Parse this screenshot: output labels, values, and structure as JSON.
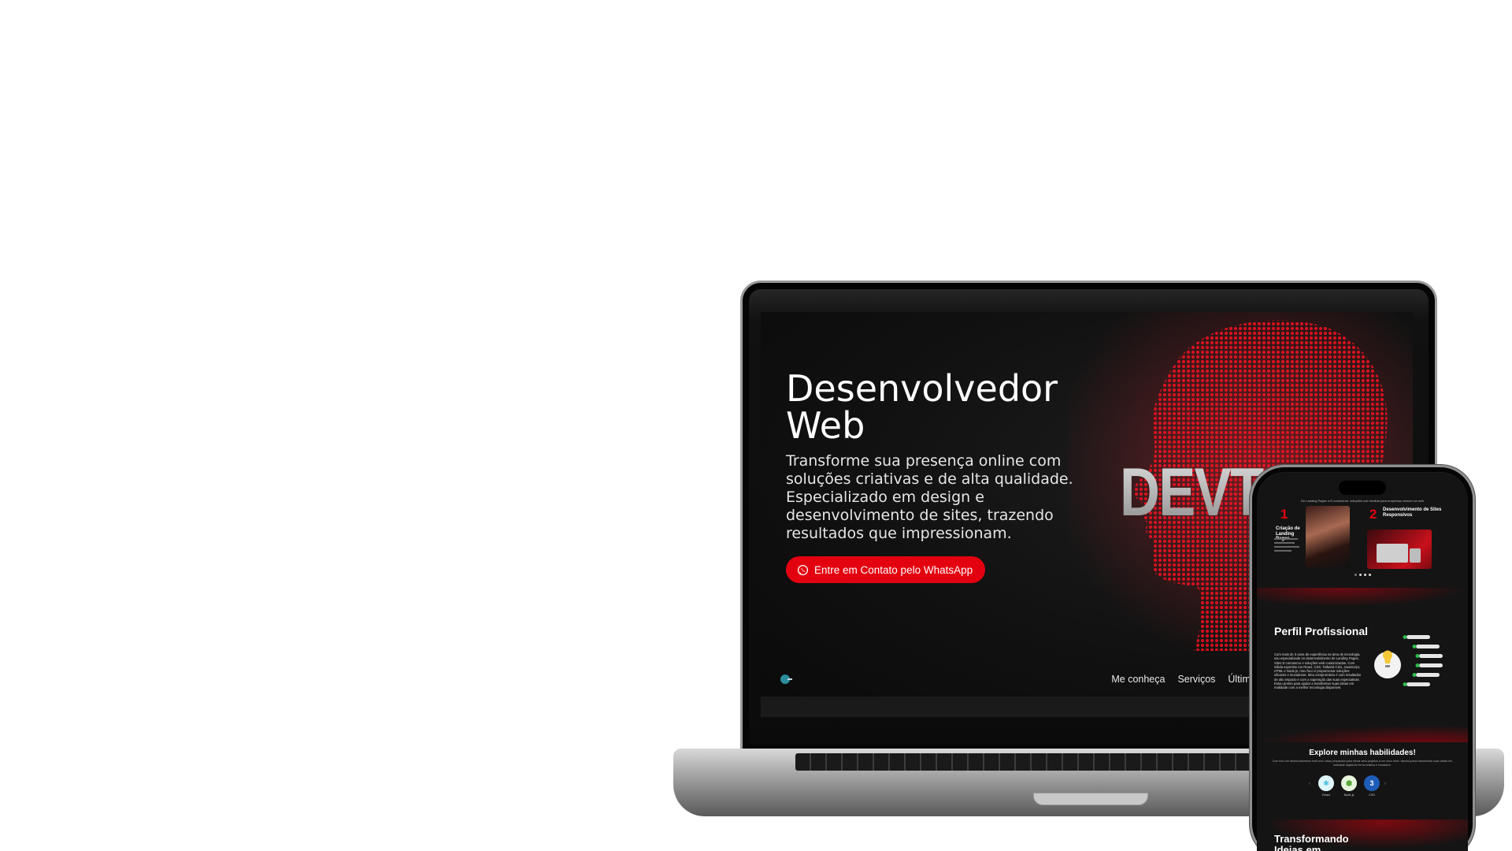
{
  "laptop_site": {
    "hero_title": "Desenvolvedor Web",
    "hero_text": "Transforme sua presença online com soluções criativas e de alta qualidade. Especializado em design e desenvolvimento de sites, trazendo resultados que impressionam.",
    "cta_label": "Entre em Contato pelo WhatsApp",
    "watermark": "DEVTI",
    "nav": [
      "Me conheça",
      "Serviços",
      "Últimos Pro"
    ]
  },
  "phone_site": {
    "services_intro": "De Landing Pages a E-commerce, soluções sob medida para empresas crescer na web",
    "services": [
      {
        "number": "1",
        "title": "Criação de Landing Pages"
      },
      {
        "number": "2",
        "title": "Desenvolvimento de Sites Responsivos"
      }
    ],
    "profile_title": "Perfil Profissional",
    "profile_text": "Com mais de 3 anos de experiência na área de tecnologia, sou especializado no desenvolvimento de Landing Pages, Sites E-commerce e soluções web customizadas. Com sólida expertise em React, CSS, Tailwind CSS, JavaScript, HTML e Node.js, meu foco é proporcionar soluções eficazes e inovadoras. Meu compromisso é com resultados de alto impacto e com a superação das suas expectativas. Estou pronto para ajudar a transformar suas ideias em realidade com a melhor tecnologia disponível.",
    "skills_title": "Explore minhas habilidades!",
    "skills_text": "Com foco em desenvolvimento front-end, estou preparado para elevar seus projetos a um novo nível. Vamos juntos transformar suas ideias em realidade digital de forma criativa e inovadora.",
    "skills": [
      {
        "label": "React",
        "icon": "react-icon"
      },
      {
        "label": "Node.js",
        "icon": "nodejs-icon"
      },
      {
        "label": "CSS",
        "icon": "css-icon"
      }
    ],
    "next_title": "Transformando Ideias em"
  },
  "colors": {
    "accent": "#e3000f",
    "screen_bg": "#111111",
    "device_frame": "#9a9a9a"
  }
}
